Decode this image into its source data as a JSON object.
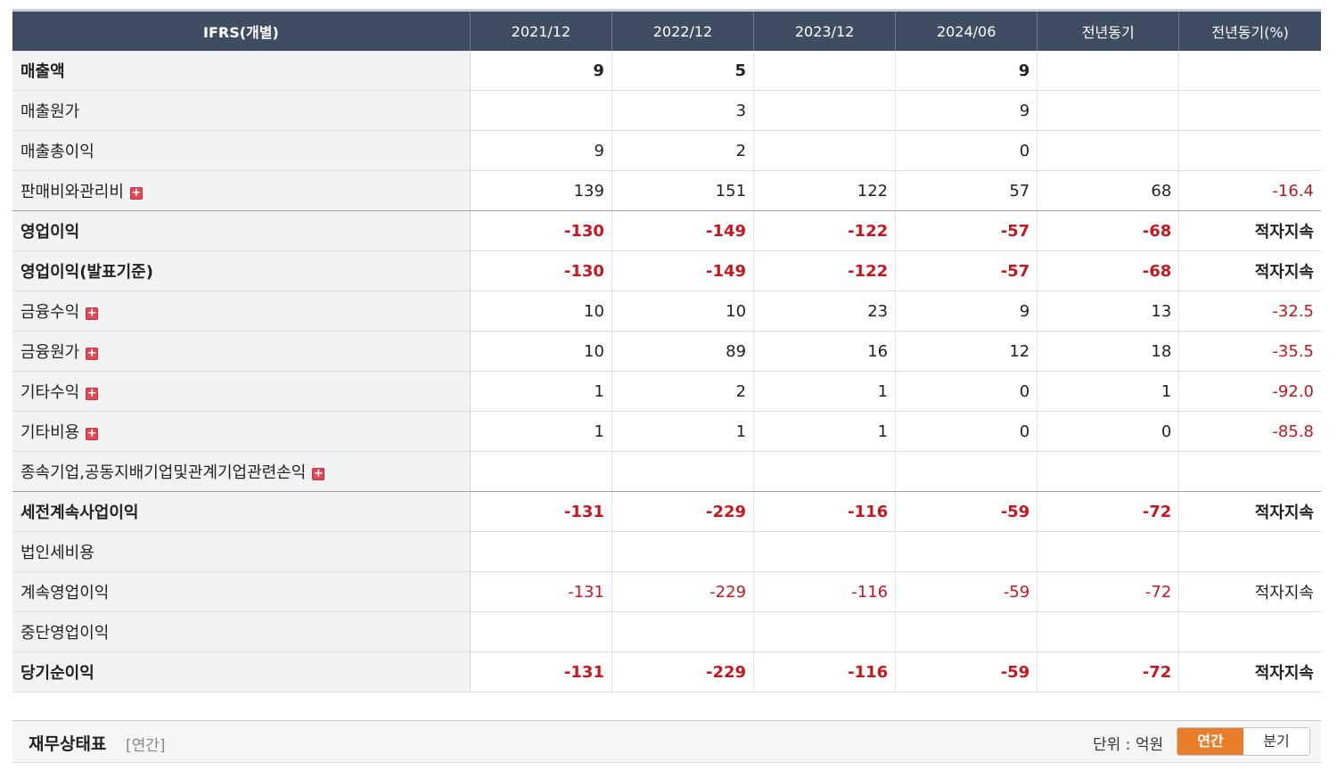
{
  "table": {
    "headers": [
      "IFRS(개별)",
      "2021/12",
      "2022/12",
      "2023/12",
      "2024/06",
      "전년동기",
      "전년동기(%)"
    ],
    "rows": [
      {
        "label": "매출액",
        "bold": true,
        "expand": false,
        "values": [
          "9",
          "5",
          "",
          "9",
          "",
          ""
        ],
        "neg": [
          false,
          false,
          false,
          false,
          false,
          false
        ]
      },
      {
        "label": "매출원가",
        "bold": false,
        "expand": false,
        "values": [
          "",
          "3",
          "",
          "9",
          "",
          ""
        ],
        "neg": [
          false,
          false,
          false,
          false,
          false,
          false
        ]
      },
      {
        "label": "매출총이익",
        "bold": false,
        "expand": false,
        "values": [
          "9",
          "2",
          "",
          "0",
          "",
          ""
        ],
        "neg": [
          false,
          false,
          false,
          false,
          false,
          false
        ]
      },
      {
        "label": "판매비와관리비",
        "bold": false,
        "expand": true,
        "values": [
          "139",
          "151",
          "122",
          "57",
          "68",
          "-16.4"
        ],
        "neg": [
          false,
          false,
          false,
          false,
          false,
          true
        ]
      },
      {
        "label": "영업이익",
        "bold": true,
        "expand": false,
        "values": [
          "-130",
          "-149",
          "-122",
          "-57",
          "-68",
          "적자지속"
        ],
        "neg": [
          true,
          true,
          true,
          true,
          true,
          false
        ]
      },
      {
        "label": "영업이익(발표기준)",
        "bold": true,
        "expand": false,
        "values": [
          "-130",
          "-149",
          "-122",
          "-57",
          "-68",
          "적자지속"
        ],
        "neg": [
          true,
          true,
          true,
          true,
          true,
          false
        ]
      },
      {
        "label": "금융수익",
        "bold": false,
        "expand": true,
        "values": [
          "10",
          "10",
          "23",
          "9",
          "13",
          "-32.5"
        ],
        "neg": [
          false,
          false,
          false,
          false,
          false,
          true
        ]
      },
      {
        "label": "금융원가",
        "bold": false,
        "expand": true,
        "values": [
          "10",
          "89",
          "16",
          "12",
          "18",
          "-35.5"
        ],
        "neg": [
          false,
          false,
          false,
          false,
          false,
          true
        ]
      },
      {
        "label": "기타수익",
        "bold": false,
        "expand": true,
        "values": [
          "1",
          "2",
          "1",
          "0",
          "1",
          "-92.0"
        ],
        "neg": [
          false,
          false,
          false,
          false,
          false,
          true
        ]
      },
      {
        "label": "기타비용",
        "bold": false,
        "expand": true,
        "values": [
          "1",
          "1",
          "1",
          "0",
          "0",
          "-85.8"
        ],
        "neg": [
          false,
          false,
          false,
          false,
          false,
          true
        ]
      },
      {
        "label": "종속기업,공동지배기업및관계기업관련손익",
        "bold": false,
        "expand": true,
        "values": [
          "",
          "",
          "",
          "",
          "",
          ""
        ],
        "neg": [
          false,
          false,
          false,
          false,
          false,
          false
        ]
      },
      {
        "label": "세전계속사업이익",
        "bold": true,
        "expand": false,
        "values": [
          "-131",
          "-229",
          "-116",
          "-59",
          "-72",
          "적자지속"
        ],
        "neg": [
          true,
          true,
          true,
          true,
          true,
          false
        ]
      },
      {
        "label": "법인세비용",
        "bold": false,
        "expand": false,
        "values": [
          "",
          "",
          "",
          "",
          "",
          ""
        ],
        "neg": [
          false,
          false,
          false,
          false,
          false,
          false
        ]
      },
      {
        "label": "계속영업이익",
        "bold": false,
        "expand": false,
        "values": [
          "-131",
          "-229",
          "-116",
          "-59",
          "-72",
          "적자지속"
        ],
        "neg": [
          true,
          true,
          true,
          true,
          true,
          false
        ]
      },
      {
        "label": "중단영업이익",
        "bold": false,
        "expand": false,
        "values": [
          "",
          "",
          "",
          "",
          "",
          ""
        ],
        "neg": [
          false,
          false,
          false,
          false,
          false,
          false
        ]
      },
      {
        "label": "당기순이익",
        "bold": true,
        "expand": false,
        "values": [
          "-131",
          "-229",
          "-116",
          "-59",
          "-72",
          "적자지속"
        ],
        "neg": [
          true,
          true,
          true,
          true,
          true,
          false
        ]
      }
    ],
    "expand_glyph": "+"
  },
  "section": {
    "title": "재무상태표",
    "subtitle": "[연간]",
    "unit": "단위 : 억원",
    "toggle": [
      "연간",
      "분기"
    ],
    "active": "연간"
  },
  "colors": {
    "header_bg": "#3e4d61",
    "negative": "#c8161d",
    "accent": "#e87e2a",
    "expand_icon": "#e04856"
  },
  "icons": [
    "plus-expand-icon"
  ]
}
